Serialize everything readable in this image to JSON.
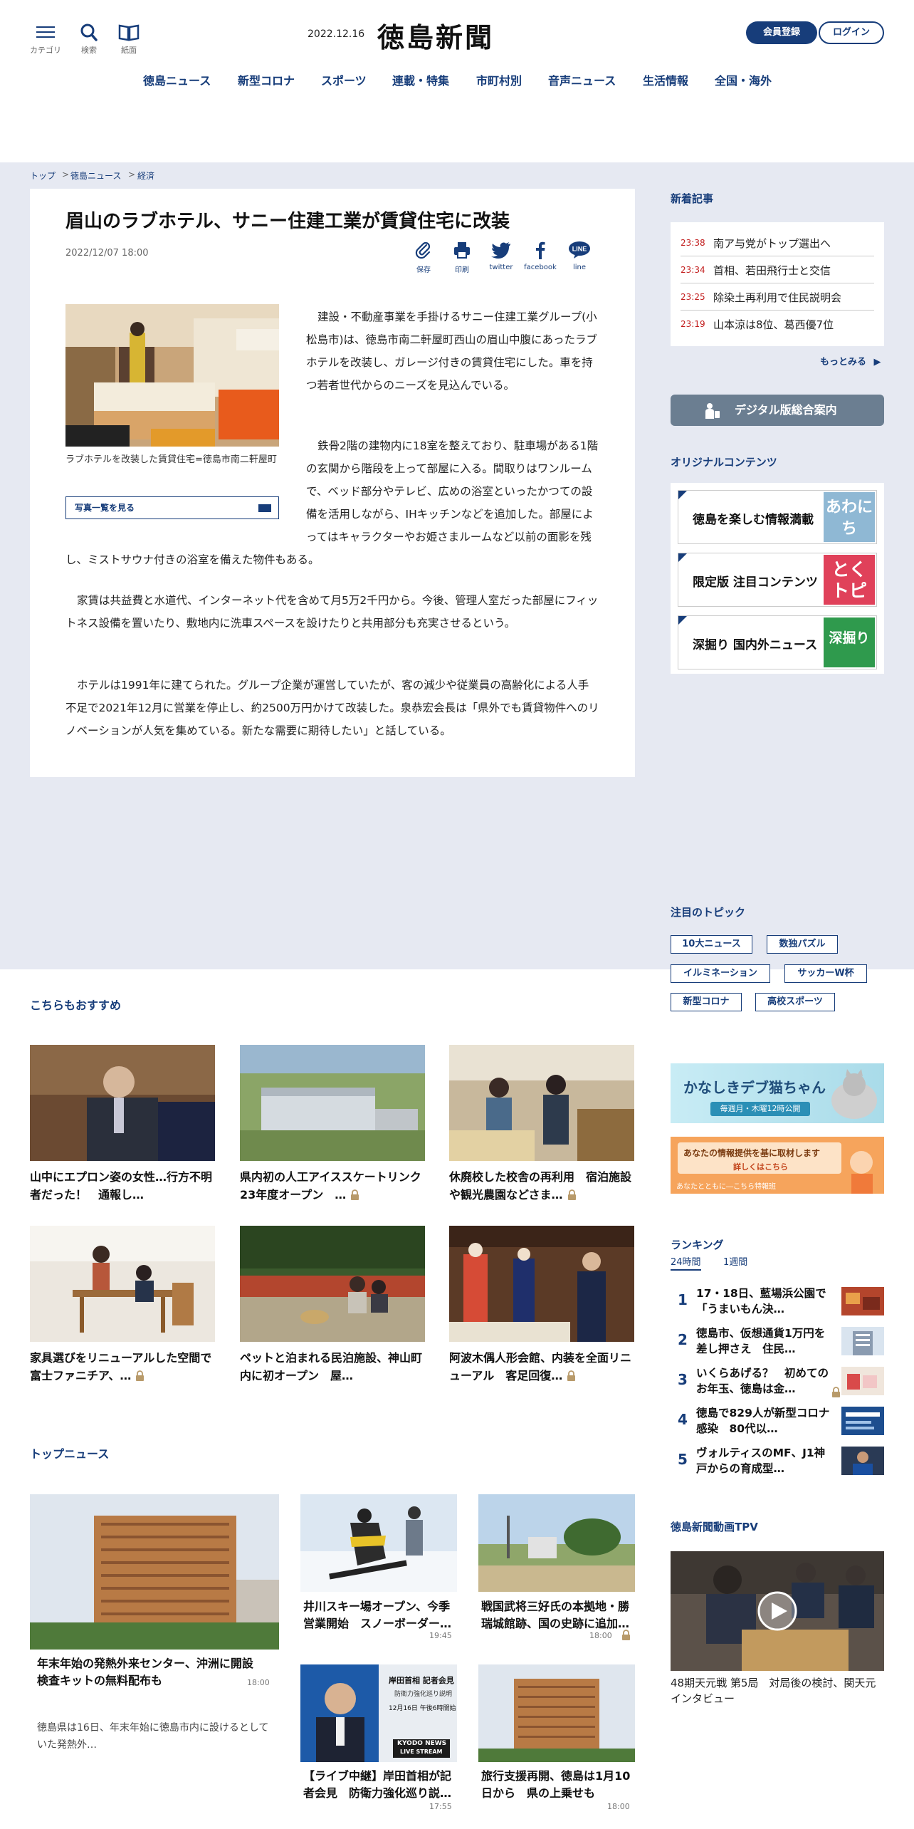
{
  "header": {
    "menu_label": "カテゴリ",
    "search_label": "検索",
    "paper_label": "紙面",
    "date": "2022.12.16",
    "logo": "徳島新聞",
    "register": "会員登録",
    "login": "ログイン",
    "nav": [
      "徳島ニュース",
      "新型コロナ",
      "スポーツ",
      "連載・特集",
      "市町村別",
      "音声ニュース",
      "生活情報",
      "全国・海外"
    ]
  },
  "breadcrumb": [
    "トップ",
    "徳島ニュース",
    "経済"
  ],
  "article": {
    "title": "眉山のラブホテル、サニー住建工業が賃貸住宅に改装",
    "date": "2022/12/07 18:00",
    "share": [
      "保存",
      "印刷",
      "twitter",
      "facebook",
      "line"
    ],
    "caption": "ラブホテルを改装した賃貸住宅=徳島市南二軒屋町",
    "photo_link": "写真一覧を見る",
    "paragraphs": [
      "建設・不動産事業を手掛けるサニー住建工業グループ(小松島市)は、徳島市南二軒屋町西山の眉山中腹にあったラブホテルを改装し、ガレージ付きの賃貸住宅にした。車を持つ若者世代からのニーズを見込んでいる。",
      "鉄骨2階の建物内に18室を整えており、駐車場がある1階の玄関から階段を上って部屋に入る。間取りはワンルームで、ベッド部分やテレビ、広めの浴室といったかつての設備を活用しながら、IHキッチンなどを追加した。部屋によってはキャラクターやお姫さまルームなど以前の面影を残し、ミストサウナ付きの浴室を備えた物件もある。",
      "家賃は共益費と水道代、インターネット代を含めて月5万2千円から。今後、管理人室だった部屋にフィットネス設備を置いたり、敷地内に洗車スペースを設けたりと共用部分も充実させるという。",
      "ホテルは1991年に建てられた。グループ企業が運営していたが、客の減少や従業員の高齢化による人手不足で2021年12月に営業を停止し、約2500万円かけて改装した。泉恭宏会長は「県外でも賃貸物件へのリノベーションが人気を集めている。新たな需要に期待したい」と話している。"
    ]
  },
  "sidebar": {
    "new_title": "新着記事",
    "new_items": [
      {
        "time": "23:38",
        "title": "南ア与党がトップ選出へ"
      },
      {
        "time": "23:34",
        "title": "首相、若田飛行士と交信"
      },
      {
        "time": "23:25",
        "title": "除染土再利用で住民説明会"
      },
      {
        "time": "23:19",
        "title": "山本涼は8位、葛西優7位"
      }
    ],
    "more": "もっとみる",
    "digital": "デジタル版総合案内",
    "original_title": "オリジナルコンテンツ",
    "original": [
      {
        "title": "徳島を楽しむ情報満載",
        "badge": "あわにち",
        "color": "#8fb8d4"
      },
      {
        "title": "限定版 注目コンテンツ",
        "badge": "とくトピ",
        "color": "#e0415a"
      },
      {
        "title": "深掘り 国内外ニュース",
        "badge": "深掘り",
        "color": "#2f9a4d"
      }
    ],
    "topics_title": "注目のトピック",
    "topics": [
      "10大ニュース",
      "数独パズル",
      "イルミネーション",
      "サッカーW杯",
      "新型コロナ",
      "高校スポーツ"
    ],
    "banner1_title": "かなしきデブ猫ちゃん",
    "banner1_sub": "毎週月・木曜12時公開",
    "banner2_main": "あなたの情報提供を基に取材します",
    "banner2_link": "詳しくはこちら",
    "banner2_foot": "あなたとともに―こちら特報班",
    "ranking_title": "ランキング",
    "ranking_tabs": [
      "24時間",
      "1週間"
    ],
    "ranking": [
      {
        "n": "1",
        "title": "17・18日、藍場浜公園で「うまいもん決…"
      },
      {
        "n": "2",
        "title": "徳島市、仮想通貨1万円を差し押さえ　住民…"
      },
      {
        "n": "3",
        "title": "いくらあげる？　初めてのお年玉、徳島は金…"
      },
      {
        "n": "4",
        "title": "徳島で829人が新型コロナ感染　80代以…"
      },
      {
        "n": "5",
        "title": "ヴォルティスのMF、J1神戸からの育成型…"
      }
    ],
    "tpv_title": "徳島新聞動画TPV",
    "tpv_caption": "48期天元戦 第5局　対局後の検討、関天元インタビュー"
  },
  "recommend": {
    "title": "こちらもおすすめ",
    "items": [
      {
        "title": "山中にエプロン姿の女性…行方不明者だった！　通報し…",
        "locked": false
      },
      {
        "title": "県内初の人工アイススケートリンク23年度オープン　…",
        "locked": true
      },
      {
        "title": "休廃校した校舎の再利用　宿泊施設や観光農園などさま…",
        "locked": true
      },
      {
        "title": "家具選びをリニューアルした空間で　富士ファニチア、…",
        "locked": true
      },
      {
        "title": "ペットと泊まれる民泊施設、神山町内に初オープン　屋…",
        "locked": false
      },
      {
        "title": "阿波木偶人形会館、内装を全面リニューアル　客足回復…",
        "locked": true
      }
    ]
  },
  "top_news": {
    "title": "トップニュース",
    "main": {
      "title": "年末年始の発熱外来センター、沖洲に開設　検査キットの無料配布も",
      "time": "18:00",
      "summary": "徳島県は16日、年末年始に徳島市内に設けるとしていた発熱外…"
    },
    "items": [
      {
        "title": "井川スキー場オープン、今季営業開始　スノーボーダー…",
        "time": "19:45",
        "locked": false
      },
      {
        "title": "戦国武将三好氏の本拠地・勝瑞城館跡、国の史跡に追加…",
        "time": "18:00",
        "locked": true
      },
      {
        "title": "【ライブ中継】岸田首相が記者会見　防衛力強化巡り説…",
        "time": "17:55",
        "locked": false
      },
      {
        "title": "旅行支援再開、徳島は1月10日から　県の上乗せも",
        "time": "18:00",
        "locked": false
      }
    ],
    "live_thumb": {
      "heading": "岸田首相 記者会見",
      "sub": "防衛力強化巡り説明",
      "datetime": "12月16日 午後6時開始",
      "brand": "KYODO NEWS",
      "live": "LIVE STREAM"
    }
  }
}
